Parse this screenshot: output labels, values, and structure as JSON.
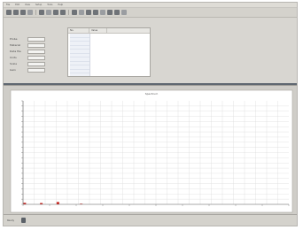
{
  "menu": {
    "items": [
      "File",
      "Edit",
      "View",
      "Setup",
      "Tools",
      "Help"
    ]
  },
  "form": {
    "fields": [
      {
        "label": "Probe",
        "value": ""
      },
      {
        "label": "Material",
        "value": ""
      },
      {
        "label": "Data file",
        "value": ""
      },
      {
        "label": "Units",
        "value": ""
      },
      {
        "label": "Scale",
        "value": ""
      },
      {
        "label": "Gain",
        "value": ""
      }
    ]
  },
  "list": {
    "headers": [
      "No.",
      "Value"
    ],
    "rows": [
      "",
      "",
      "",
      "",
      "",
      "",
      "",
      "",
      "",
      "",
      "",
      "",
      ""
    ]
  },
  "chart": {
    "title": "Spectrum",
    "ylabel": ""
  },
  "chart_data": {
    "type": "bar",
    "categories": [
      "1",
      "2",
      "3",
      "4",
      "5",
      "6",
      "7",
      "8",
      "9",
      "10",
      "11",
      "12",
      "13",
      "14",
      "15",
      "16",
      "17",
      "18",
      "19",
      "20",
      "21",
      "22",
      "23",
      "24",
      "25",
      "26",
      "27",
      "28",
      "29",
      "30",
      "31",
      "32",
      "33",
      "34",
      "35",
      "36",
      "37",
      "38",
      "39",
      "40",
      "41",
      "42",
      "43",
      "44",
      "45",
      "46",
      "47",
      "48",
      "49",
      "50",
      "51",
      "52",
      "53",
      "54",
      "55",
      "56",
      "57",
      "58",
      "59",
      "60",
      "61",
      "62",
      "63",
      "64",
      "65",
      "66",
      "67",
      "68",
      "69",
      "70",
      "71",
      "72",
      "73",
      "74",
      "75",
      "76",
      "77",
      "78",
      "79",
      "80"
    ],
    "values": [
      1.5,
      0,
      0,
      0,
      0,
      1.3,
      0,
      0,
      0,
      0,
      2.3,
      0,
      0,
      0,
      0,
      0,
      0,
      0.6,
      0,
      0,
      0,
      0,
      0,
      0,
      0,
      0,
      0,
      0,
      0,
      0,
      0,
      0,
      0,
      0,
      0,
      0,
      0,
      0,
      0,
      0,
      0,
      0,
      0,
      0,
      0,
      0,
      0,
      0,
      0,
      0,
      0,
      0,
      0,
      0,
      0,
      0,
      0,
      0,
      0,
      0,
      0,
      0,
      0,
      0,
      0,
      0,
      0,
      0,
      0,
      0,
      0,
      0,
      0,
      0,
      0,
      0,
      0,
      0,
      0,
      0
    ],
    "ylim": [
      0,
      100
    ],
    "grid": true,
    "bar_color": "#cc2a24"
  },
  "status": {
    "segments": [
      "Ready",
      "",
      ""
    ]
  }
}
